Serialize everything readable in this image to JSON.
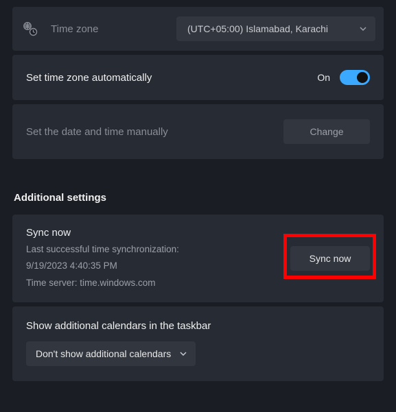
{
  "timezone": {
    "icon": "globe-clock-icon",
    "label": "Time zone",
    "value": "(UTC+05:00) Islamabad, Karachi"
  },
  "auto_tz": {
    "label": "Set time zone automatically",
    "state": "On"
  },
  "manual": {
    "label": "Set the date and time manually",
    "button": "Change"
  },
  "additional": {
    "heading": "Additional settings"
  },
  "sync": {
    "title": "Sync now",
    "last_label": "Last successful time synchronization:",
    "last_value": "9/19/2023 4:40:35 PM",
    "server_line": "Time server: time.windows.com",
    "button": "Sync now"
  },
  "calendars": {
    "label": "Show additional calendars in the taskbar",
    "value": "Don't show additional calendars"
  }
}
